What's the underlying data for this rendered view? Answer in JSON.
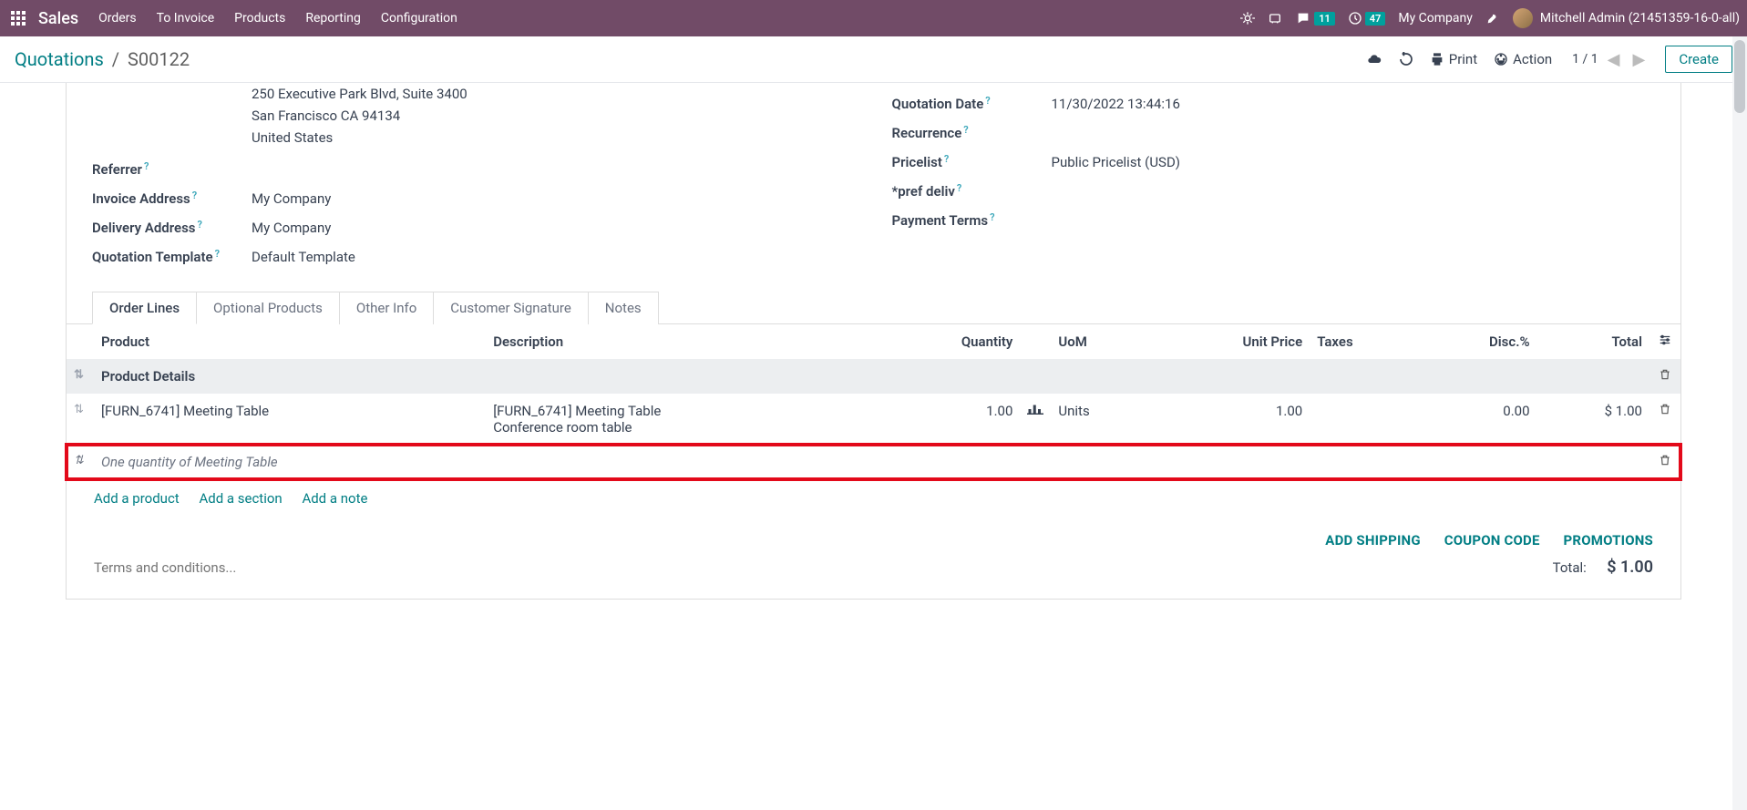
{
  "topbar": {
    "brand": "Sales",
    "nav": [
      "Orders",
      "To Invoice",
      "Products",
      "Reporting",
      "Configuration"
    ],
    "messages_badge": "11",
    "activities_badge": "47",
    "company": "My Company",
    "user": "Mitchell Admin (21451359-16-0-all)"
  },
  "controlbar": {
    "crumb_root": "Quotations",
    "crumb_current": "S00122",
    "print": "Print",
    "action": "Action",
    "pager": "1 / 1",
    "create": "Create"
  },
  "form": {
    "address_lines": [
      "250 Executive Park Blvd, Suite 3400",
      "San Francisco CA 94134",
      "United States"
    ],
    "referrer_label": "Referrer",
    "invoice_addr_label": "Invoice Address",
    "invoice_addr_val": "My Company",
    "delivery_addr_label": "Delivery Address",
    "delivery_addr_val": "My Company",
    "quote_tmpl_label": "Quotation Template",
    "quote_tmpl_val": "Default Template",
    "quote_date_label": "Quotation Date",
    "quote_date_val": "11/30/2022 13:44:16",
    "recurrence_label": "Recurrence",
    "pricelist_label": "Pricelist",
    "pricelist_val": "Public Pricelist (USD)",
    "pref_deliv_label": "*pref deliv",
    "payment_terms_label": "Payment Terms"
  },
  "tabs": [
    "Order Lines",
    "Optional Products",
    "Other Info",
    "Customer Signature",
    "Notes"
  ],
  "table": {
    "headers": {
      "product": "Product",
      "description": "Description",
      "quantity": "Quantity",
      "uom": "UoM",
      "unit_price": "Unit Price",
      "taxes": "Taxes",
      "disc": "Disc.%",
      "total": "Total"
    },
    "section": "Product Details",
    "row": {
      "product": "[FURN_6741] Meeting Table",
      "desc_l1": "[FURN_6741] Meeting Table",
      "desc_l2": "Conference room table",
      "qty": "1.00",
      "uom": "Units",
      "unit_price": "1.00",
      "disc": "0.00",
      "total": "$ 1.00"
    },
    "note": "One quantity of Meeting Table",
    "add_product": "Add a product",
    "add_section": "Add a section",
    "add_note": "Add a note"
  },
  "footer": {
    "shipping": "ADD SHIPPING",
    "coupon": "COUPON CODE",
    "promotions": "PROMOTIONS",
    "terms_placeholder": "Terms and conditions...",
    "total_label": "Total:",
    "total_val": "$ 1.00"
  }
}
